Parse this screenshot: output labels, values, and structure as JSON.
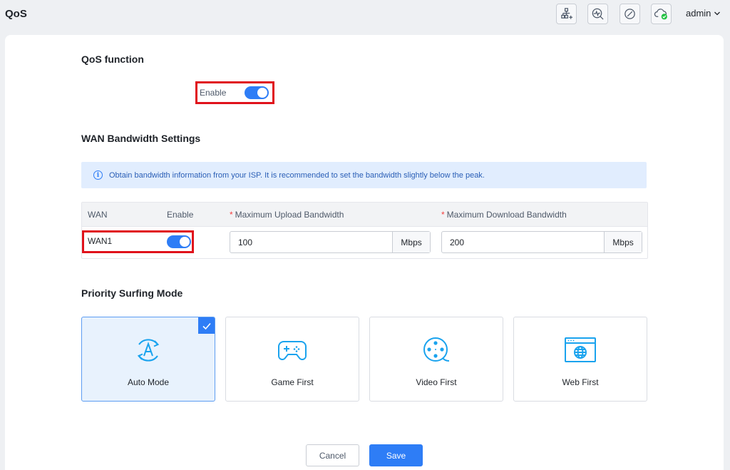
{
  "header": {
    "title": "QoS",
    "icons": [
      "network-topology-icon",
      "diagnostics-icon",
      "block-icon",
      "cloud-connected-icon"
    ],
    "user": "admin"
  },
  "qos_function": {
    "title": "QoS function",
    "enable_label": "Enable",
    "enabled": true
  },
  "wan_bandwidth": {
    "title": "WAN Bandwidth Settings",
    "info": "Obtain bandwidth information from your ISP. It is recommended to set the bandwidth slightly below the peak.",
    "columns": {
      "wan": "WAN",
      "enable": "Enable",
      "upload": "Maximum Upload Bandwidth",
      "download": "Maximum Download Bandwidth"
    },
    "rows": [
      {
        "name": "WAN1",
        "enabled": true,
        "upload": "100",
        "upload_unit": "Mbps",
        "download": "200",
        "download_unit": "Mbps"
      }
    ]
  },
  "priority": {
    "title": "Priority Surfing Mode",
    "modes": [
      {
        "label": "Auto Mode",
        "icon": "auto-mode-icon",
        "selected": true
      },
      {
        "label": "Game First",
        "icon": "gamepad-icon",
        "selected": false
      },
      {
        "label": "Video First",
        "icon": "film-reel-icon",
        "selected": false
      },
      {
        "label": "Web First",
        "icon": "browser-globe-icon",
        "selected": false
      }
    ]
  },
  "actions": {
    "cancel": "Cancel",
    "save": "Save"
  },
  "colors": {
    "accent": "#2e7df6",
    "highlight": "#e0121b",
    "icon_cyan": "#1aa3ee"
  }
}
